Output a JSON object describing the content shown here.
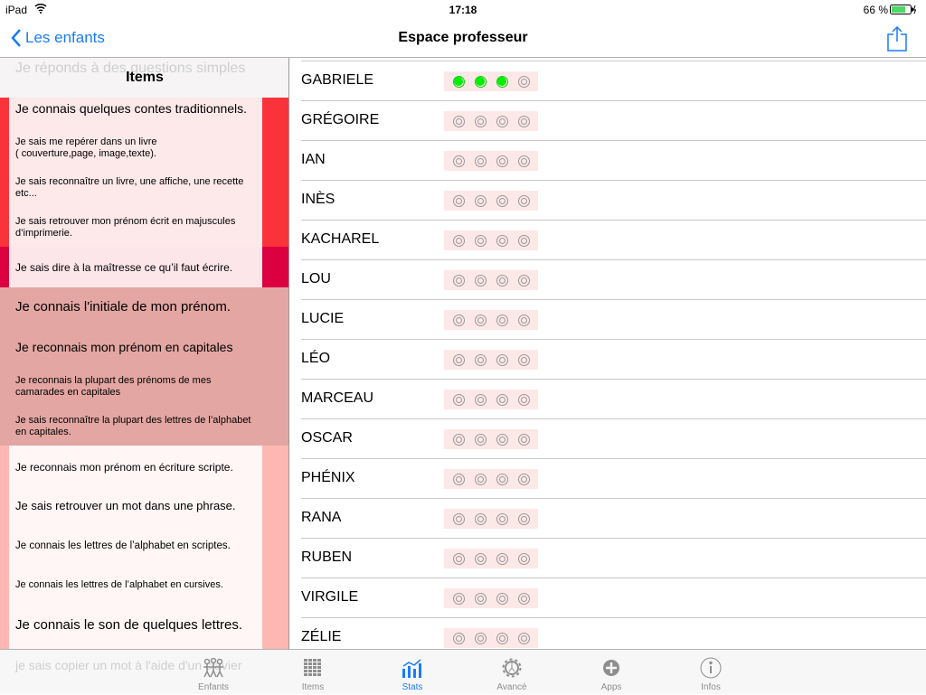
{
  "status": {
    "device": "iPad",
    "time": "17:18",
    "battery": "66 %"
  },
  "nav": {
    "back_label": "Les enfants",
    "title": "Espace professeur"
  },
  "left": {
    "header": "Items",
    "faded_top": "Je réponds à des questions simples",
    "faded_bottom": "je sais copier un mot à l'aide d'un clavier",
    "items": [
      {
        "text": "Je connais quelques contes traditionnels."
      },
      {
        "text": "Je sais me repérer dans un livre\n( couverture,page, image,texte)."
      },
      {
        "text": "Je sais reconnaître un livre, une affiche, une recette etc..."
      },
      {
        "text": "Je sais retrouver mon prénom écrit en majuscules d’imprimerie."
      },
      {
        "text": "Je sais dire à la maîtresse ce qu’il faut écrire."
      },
      {
        "text": "Je connais l'initiale de mon prénom."
      },
      {
        "text": "Je reconnais mon prénom en capitales"
      },
      {
        "text": "Je reconnais la plupart des prénoms de mes camarades en capitales"
      },
      {
        "text": "Je sais reconnaître la plupart des lettres de l’alphabet en capitales."
      },
      {
        "text": "Je reconnais mon prénom en écriture scripte."
      },
      {
        "text": "Je sais retrouver un mot dans une phrase."
      },
      {
        "text": "Je connais les lettres de l’alphabet en scriptes."
      },
      {
        "text": "Je connais les lettres de l’alphabet en cursives."
      },
      {
        "text": "Je connais le son de quelques lettres."
      }
    ],
    "section_colors": {
      "red": "#fa323a",
      "crimson": "#dc0040",
      "dusty": "#e3a6a2",
      "salmon": "#ffb7b3"
    }
  },
  "students": [
    {
      "name": "GABRIELE",
      "level": 3
    },
    {
      "name": "GRÉGOIRE",
      "level": 0
    },
    {
      "name": "IAN",
      "level": 0
    },
    {
      "name": "INÈS",
      "level": 0
    },
    {
      "name": "KACHAREL",
      "level": 0
    },
    {
      "name": "LOU",
      "level": 0
    },
    {
      "name": "LUCIE",
      "level": 0
    },
    {
      "name": "LÉO",
      "level": 0
    },
    {
      "name": "MARCEAU",
      "level": 0
    },
    {
      "name": "OSCAR",
      "level": 0
    },
    {
      "name": "PHÉNIX",
      "level": 0
    },
    {
      "name": "RANA",
      "level": 0
    },
    {
      "name": "RUBEN",
      "level": 0
    },
    {
      "name": "VIRGILE",
      "level": 0
    },
    {
      "name": "ZÉLIE",
      "level": 0
    }
  ],
  "tabs": [
    {
      "label": "Enfants",
      "icon": "children-icon"
    },
    {
      "label": "Items",
      "icon": "grid-icon"
    },
    {
      "label": "Stats",
      "icon": "stats-icon",
      "active": true
    },
    {
      "label": "Avancé",
      "icon": "gear-icon"
    },
    {
      "label": "Apps",
      "icon": "plus-circle-icon"
    },
    {
      "label": "Infos",
      "icon": "info-icon"
    }
  ],
  "accent": "#1a7cf7"
}
